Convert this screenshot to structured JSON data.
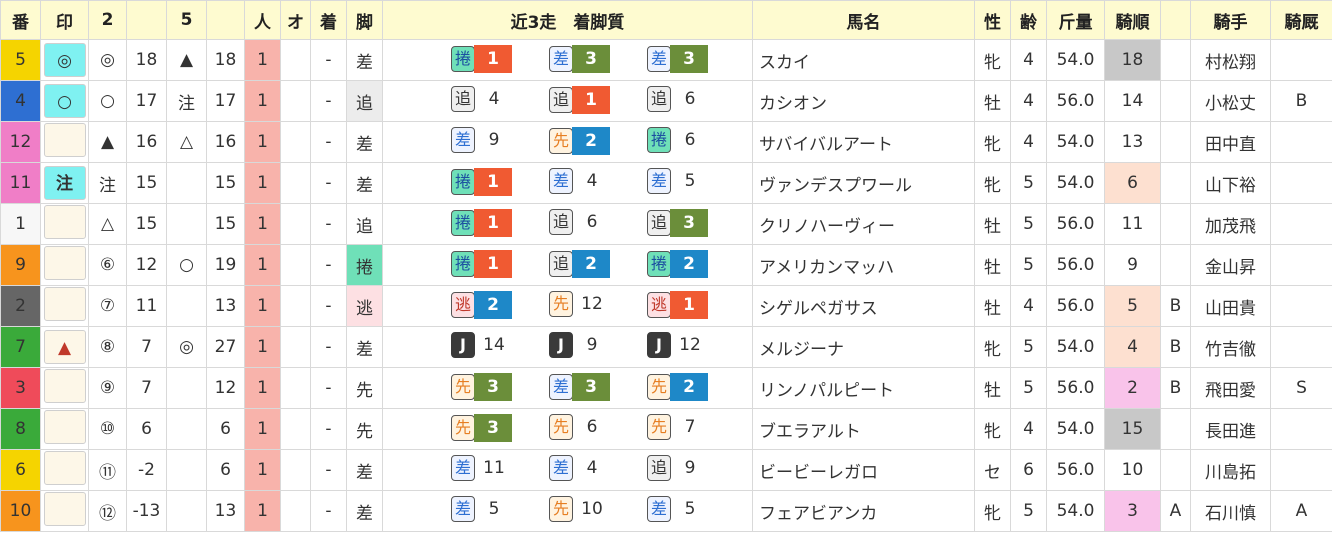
{
  "headers": {
    "ban": "番",
    "shirushi": "印",
    "col2": "2",
    "col5": "5",
    "ninki": "人",
    "o": "オ",
    "chaku": "着",
    "ashi": "脚",
    "recent": "近3走　着脚質",
    "bamei": "馬名",
    "sex": "性",
    "age": "齢",
    "kinryo": "斤量",
    "kijun": "騎順",
    "jockey": "騎手",
    "kijun_ura": "騎厩"
  },
  "rows": [
    {
      "waku": 5,
      "no": "5",
      "mark": "◎",
      "mark_active": true,
      "m2": "◎",
      "m2c": "red",
      "v2": "18",
      "v2c": "red",
      "m5": "▲",
      "m5c": "blue",
      "v5": "18",
      "v5c": "blue",
      "ninki": "1",
      "chaku": "-",
      "ashi": "差",
      "ashi_cls": "ashi-sa",
      "runs": [
        {
          "s": "捲",
          "sc": "maku",
          "r": "1"
        },
        {
          "s": "差",
          "sc": "sa",
          "r": "3"
        },
        {
          "s": "差",
          "sc": "sa",
          "r": "3"
        }
      ],
      "name": "スカイ",
      "sex": "牝",
      "age": "4",
      "kin": "54.0",
      "kijun": "18",
      "kijun_bg": "gray",
      "mark_b": "",
      "jockey": "村松翔",
      "grade": ""
    },
    {
      "waku": 4,
      "no": "4",
      "mark": "○",
      "mark_active": true,
      "m2": "○",
      "m2c": "red",
      "v2": "17",
      "v2c": "red",
      "m5": "注",
      "m5c": "blue",
      "v5": "17",
      "v5c": "blue",
      "ninki": "1",
      "chaku": "-",
      "ashi": "追",
      "ashi_cls": "ashi-oi",
      "runs": [
        {
          "s": "追",
          "sc": "oi",
          "r": "4"
        },
        {
          "s": "追",
          "sc": "oi",
          "r": "1"
        },
        {
          "s": "追",
          "sc": "oi",
          "r": "6"
        }
      ],
      "name": "カシオン",
      "sex": "牡",
      "age": "4",
      "kin": "56.0",
      "kijun": "14",
      "kijun_bg": "",
      "mark_b": "",
      "jockey": "小松丈",
      "grade": "B"
    },
    {
      "waku": 8,
      "no": "12",
      "mark": "",
      "mark_active": false,
      "m2": "▲",
      "m2c": "red",
      "v2": "16",
      "v2c": "red",
      "m5": "△",
      "m5c": "blue",
      "v5": "16",
      "v5c": "blue",
      "ninki": "1",
      "chaku": "-",
      "ashi": "差",
      "ashi_cls": "ashi-sa",
      "runs": [
        {
          "s": "差",
          "sc": "sa",
          "r": "9"
        },
        {
          "s": "先",
          "sc": "sen",
          "r": "2"
        },
        {
          "s": "捲",
          "sc": "maku",
          "r": "6"
        }
      ],
      "name": "サバイバルアート",
      "sex": "牝",
      "age": "4",
      "kin": "54.0",
      "kijun": "13",
      "kijun_bg": "",
      "mark_b": "",
      "jockey": "田中直",
      "grade": ""
    },
    {
      "waku": 8,
      "no": "11",
      "mark": "注",
      "mark_active": true,
      "m2": "注",
      "m2c": "red",
      "v2": "15",
      "v2c": "red",
      "m5": "",
      "m5c": "",
      "v5": "15",
      "v5c": "gray",
      "ninki": "1",
      "chaku": "-",
      "ashi": "差",
      "ashi_cls": "ashi-sa",
      "runs": [
        {
          "s": "捲",
          "sc": "maku",
          "r": "1"
        },
        {
          "s": "差",
          "sc": "sa",
          "r": "4"
        },
        {
          "s": "差",
          "sc": "sa",
          "r": "5"
        }
      ],
      "name": "ヴァンデスプワール",
      "sex": "牝",
      "age": "5",
      "kin": "54.0",
      "kijun": "6",
      "kijun_bg": "peach",
      "mark_b": "",
      "jockey": "山下裕",
      "grade": ""
    },
    {
      "waku": 1,
      "no": "1",
      "mark": "",
      "mark_active": false,
      "m2": "△",
      "m2c": "red",
      "v2": "15",
      "v2c": "red",
      "m5": "",
      "m5c": "",
      "v5": "15",
      "v5c": "gray",
      "ninki": "1",
      "chaku": "-",
      "ashi": "追",
      "ashi_cls": "ashi-text-oi",
      "runs": [
        {
          "s": "捲",
          "sc": "maku",
          "r": "1"
        },
        {
          "s": "追",
          "sc": "oi",
          "r": "6"
        },
        {
          "s": "追",
          "sc": "oi",
          "r": "3"
        }
      ],
      "name": "クリノハーヴィー",
      "sex": "牡",
      "age": "5",
      "kin": "56.0",
      "kijun": "11",
      "kijun_bg": "",
      "mark_b": "",
      "jockey": "加茂飛",
      "grade": ""
    },
    {
      "waku": 7,
      "no": "9",
      "mark": "",
      "mark_active": false,
      "m2": "⑥",
      "m2c": "gray",
      "v2": "12",
      "v2c": "gray",
      "m5": "○",
      "m5c": "blue",
      "v5": "19",
      "v5c": "blue",
      "ninki": "1",
      "chaku": "-",
      "ashi": "捲",
      "ashi_cls": "ashi-maku",
      "runs": [
        {
          "s": "捲",
          "sc": "maku",
          "r": "1"
        },
        {
          "s": "追",
          "sc": "oi",
          "r": "2"
        },
        {
          "s": "捲",
          "sc": "maku",
          "r": "2"
        }
      ],
      "name": "アメリカンマッハ",
      "sex": "牡",
      "age": "5",
      "kin": "56.0",
      "kijun": "9",
      "kijun_bg": "",
      "mark_b": "",
      "jockey": "金山昇",
      "grade": ""
    },
    {
      "waku": 2,
      "no": "2",
      "mark": "",
      "mark_active": false,
      "m2": "⑦",
      "m2c": "gray",
      "v2": "11",
      "v2c": "gray",
      "m5": "",
      "m5c": "",
      "v5": "13",
      "v5c": "gray",
      "ninki": "1",
      "chaku": "-",
      "ashi": "逃",
      "ashi_cls": "ashi-nige",
      "runs": [
        {
          "s": "逃",
          "sc": "nige",
          "r": "2"
        },
        {
          "s": "先",
          "sc": "sen",
          "r": "12"
        },
        {
          "s": "逃",
          "sc": "nige",
          "r": "1"
        }
      ],
      "name": "シゲルペガサス",
      "sex": "牡",
      "age": "4",
      "kin": "56.0",
      "kijun": "5",
      "kijun_bg": "peach",
      "mark_b": "B",
      "jockey": "山田貴",
      "grade": ""
    },
    {
      "waku": 6,
      "no": "7",
      "mark": "▲",
      "mark_active": false,
      "m2": "⑧",
      "m2c": "gray",
      "v2": "7",
      "v2c": "gray",
      "m5": "◎",
      "m5c": "blue",
      "v5": "27",
      "v5c": "blue",
      "ninki": "1",
      "chaku": "-",
      "ashi": "差",
      "ashi_cls": "ashi-sa",
      "runs": [
        {
          "s": "J",
          "sc": "j",
          "r": "14"
        },
        {
          "s": "J",
          "sc": "j",
          "r": "9"
        },
        {
          "s": "J",
          "sc": "j",
          "r": "12"
        }
      ],
      "name": "メルジーナ",
      "sex": "牝",
      "age": "5",
      "kin": "54.0",
      "kijun": "4",
      "kijun_bg": "peach",
      "mark_b": "B",
      "jockey": "竹吉徹",
      "grade": ""
    },
    {
      "waku": 3,
      "no": "3",
      "mark": "",
      "mark_active": false,
      "m2": "⑨",
      "m2c": "gray",
      "v2": "7",
      "v2c": "gray",
      "m5": "",
      "m5c": "",
      "v5": "12",
      "v5c": "gray",
      "ninki": "1",
      "chaku": "-",
      "ashi": "先",
      "ashi_cls": "ashi-sen",
      "runs": [
        {
          "s": "先",
          "sc": "sen",
          "r": "3"
        },
        {
          "s": "差",
          "sc": "sa",
          "r": "3"
        },
        {
          "s": "先",
          "sc": "sen",
          "r": "2"
        }
      ],
      "name": "リンノパルピート",
      "sex": "牡",
      "age": "5",
      "kin": "56.0",
      "kijun": "2",
      "kijun_bg": "pink",
      "mark_b": "B",
      "jockey": "飛田愛",
      "grade": "S"
    },
    {
      "waku": 6,
      "no": "8",
      "mark": "",
      "mark_active": false,
      "m2": "⑩",
      "m2c": "gray",
      "v2": "6",
      "v2c": "gray",
      "m5": "",
      "m5c": "",
      "v5": "6",
      "v5c": "gray",
      "ninki": "1",
      "chaku": "-",
      "ashi": "先",
      "ashi_cls": "ashi-sen",
      "runs": [
        {
          "s": "先",
          "sc": "sen",
          "r": "3"
        },
        {
          "s": "先",
          "sc": "sen",
          "r": "6"
        },
        {
          "s": "先",
          "sc": "sen",
          "r": "7"
        }
      ],
      "name": "ブエラアルト",
      "sex": "牝",
      "age": "4",
      "kin": "54.0",
      "kijun": "15",
      "kijun_bg": "gray",
      "mark_b": "",
      "jockey": "長田進",
      "grade": ""
    },
    {
      "waku": 5,
      "no": "6",
      "mark": "",
      "mark_active": false,
      "m2": "⑪",
      "m2c": "gray",
      "v2": "-2",
      "v2c": "gray",
      "m5": "",
      "m5c": "",
      "v5": "6",
      "v5c": "gray",
      "ninki": "1",
      "chaku": "-",
      "ashi": "差",
      "ashi_cls": "ashi-sa",
      "runs": [
        {
          "s": "差",
          "sc": "sa",
          "r": "11"
        },
        {
          "s": "差",
          "sc": "sa",
          "r": "4"
        },
        {
          "s": "追",
          "sc": "oi",
          "r": "9"
        }
      ],
      "name": "ビービーレガロ",
      "sex": "セ",
      "age": "6",
      "kin": "56.0",
      "kijun": "10",
      "kijun_bg": "",
      "mark_b": "",
      "jockey": "川島拓",
      "grade": ""
    },
    {
      "waku": 7,
      "no": "10",
      "mark": "",
      "mark_active": false,
      "m2": "⑫",
      "m2c": "gray",
      "v2": "-13",
      "v2c": "gray",
      "m5": "",
      "m5c": "",
      "v5": "13",
      "v5c": "gray",
      "ninki": "1",
      "chaku": "-",
      "ashi": "差",
      "ashi_cls": "ashi-sa",
      "runs": [
        {
          "s": "差",
          "sc": "sa",
          "r": "5"
        },
        {
          "s": "先",
          "sc": "sen",
          "r": "10"
        },
        {
          "s": "差",
          "sc": "sa",
          "r": "5"
        }
      ],
      "name": "フェアビアンカ",
      "sex": "牝",
      "age": "5",
      "kin": "54.0",
      "kijun": "3",
      "kijun_bg": "pink",
      "mark_b": "A",
      "jockey": "石川慎",
      "grade": "A"
    }
  ]
}
